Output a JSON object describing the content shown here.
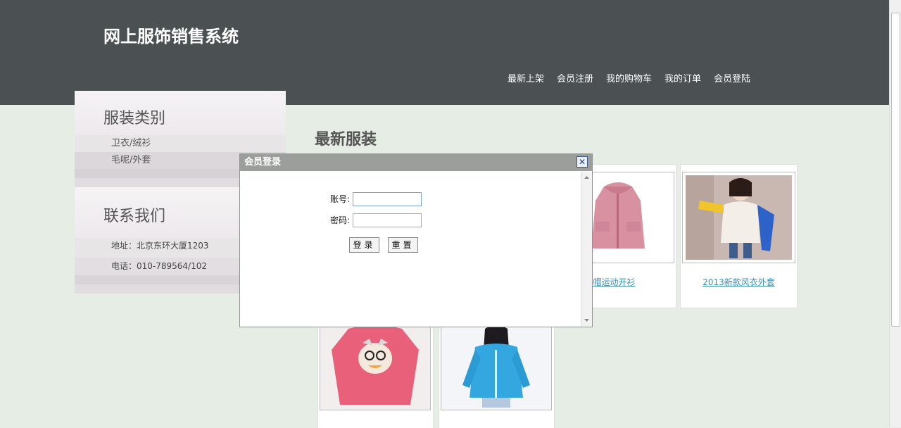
{
  "site": {
    "title": "网上服饰销售系统"
  },
  "nav": [
    {
      "label": "最新上架"
    },
    {
      "label": "会员注册"
    },
    {
      "label": "我的购物车"
    },
    {
      "label": "我的订单"
    },
    {
      "label": "会员登陆"
    }
  ],
  "sidebar": {
    "categories_title": "服装类别",
    "categories": [
      {
        "label": "卫衣/绒衫"
      },
      {
        "label": "毛呢/外套"
      }
    ],
    "contact_title": "联系我们",
    "contact": {
      "address": "地址：北京东环大厦1203",
      "phone": "电话：010-789564/102"
    }
  },
  "main": {
    "section_title": "最新服装",
    "products": [
      {
        "name": "链连帽运动开衫"
      },
      {
        "name": "2013新款风衣外套"
      }
    ]
  },
  "login_dialog": {
    "title": "会员登录",
    "close_icon": "✕",
    "account_label": "账号:",
    "account_value": "",
    "password_label": "密码:",
    "password_value": "",
    "login_button": "登录",
    "reset_button": "重置"
  },
  "colors": {
    "header_bg": "#4b5152",
    "page_bg": "#e6ede4",
    "dialog_title_bg": "#9c9e9c",
    "link": "#3a8fb5"
  }
}
